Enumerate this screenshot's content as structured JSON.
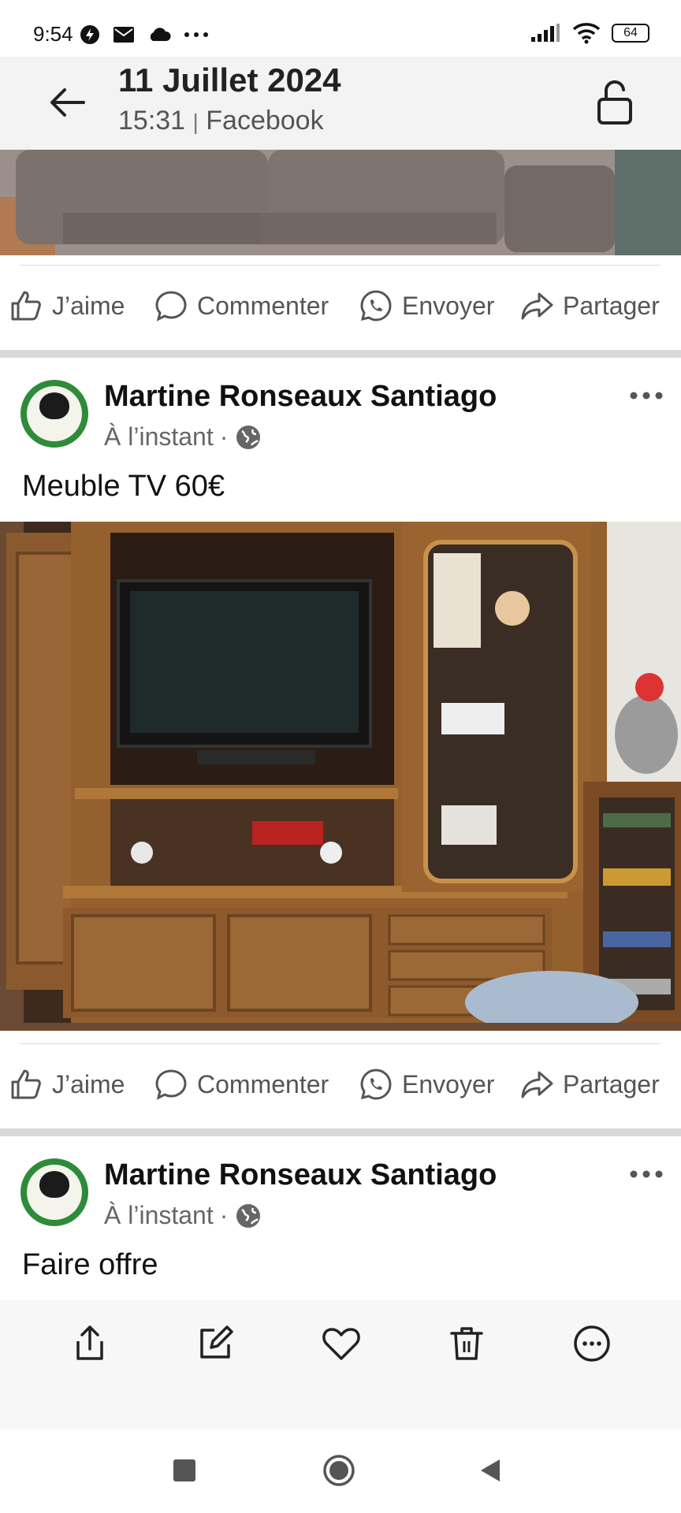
{
  "status": {
    "time": "9:54",
    "battery": "64",
    "left_icons": [
      "flash-icon",
      "mail-icon",
      "cloud-icon",
      "more-horizontal-icon"
    ],
    "right_icons": [
      "signal-icon",
      "wifi-icon",
      "battery-icon"
    ]
  },
  "header": {
    "date": "11 Juillet 2024",
    "time": "15:31",
    "separator": "|",
    "source": "Facebook"
  },
  "actions": {
    "like": "J’aime",
    "comment": "Commenter",
    "send": "Envoyer",
    "share": "Partager"
  },
  "posts": [
    {
      "author": "Martine Ronseaux Santiago",
      "time": "À l’instant",
      "dot": "·",
      "text": "Meuble TV 60€"
    },
    {
      "author": "Martine Ronseaux Santiago",
      "time": "À l’instant",
      "dot": "·",
      "text": "Faire offre"
    }
  ],
  "toolbar": [
    "share-icon",
    "edit-icon",
    "heart-icon",
    "trash-icon",
    "more-icon"
  ],
  "nav": [
    "recents-button",
    "home-button",
    "back-button"
  ],
  "colors": {
    "avatar_ring": "#2e8b3a",
    "header_bg": "#f3f3f3",
    "separator": "#d9d9d9"
  }
}
